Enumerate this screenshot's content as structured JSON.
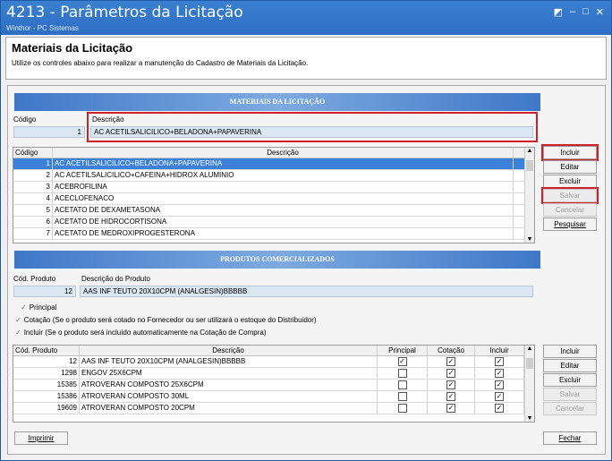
{
  "window": {
    "title": "4213 - Parâmetros da Licitação",
    "subtitle": "Winthor - PC Sistemas",
    "controls": [
      "◩",
      "–",
      "□",
      "✕"
    ]
  },
  "header": {
    "title": "Materiais da Licitação",
    "description": "Utilize os controles abaixo para realizar a manutenção do Cadastro de Materiais da Licitação."
  },
  "materiais": {
    "band": "MATERIAIS DA LICITAÇÃO",
    "codigo_label": "Código",
    "descricao_label": "Descrição",
    "codigo_value": "1",
    "descricao_value": "AC ACETILSALICILICO+BELADONA+PAPAVERINA",
    "grid": {
      "columns": [
        "Código",
        "Descrição"
      ],
      "rows": [
        {
          "codigo": "1",
          "descricao": "AC ACETILSALICILICO+BELADONA+PAPAVERINA"
        },
        {
          "codigo": "2",
          "descricao": "AC ACETILSALICILICO+CAFEINA+HIDROX ALUMINIO"
        },
        {
          "codigo": "3",
          "descricao": "ACEBROFILINA"
        },
        {
          "codigo": "4",
          "descricao": "ACECLOFENACO"
        },
        {
          "codigo": "5",
          "descricao": "ACETATO DE DEXAMETASONA"
        },
        {
          "codigo": "6",
          "descricao": "ACETATO DE HIDROCORTISONA"
        },
        {
          "codigo": "7",
          "descricao": "ACETATO DE MEDROXIPROGESTERONA"
        }
      ]
    },
    "buttons": {
      "incluir": "Incluir",
      "editar": "Editar",
      "excluir": "Excluir",
      "salvar": "Salvar",
      "cancelar": "Cancelar",
      "pesquisar": "Pesquisar"
    }
  },
  "produtos": {
    "band": "PRODUTOS COMERCIALIZADOS",
    "cod_label": "Cód. Produto",
    "desc_label": "Descrição do Produto",
    "cod_value": "12",
    "desc_value": "AAS INF TEUTO 20X10CPM (ANALGESIN)BBBBB",
    "options": [
      {
        "label": "Principal"
      },
      {
        "label": "Cotação (Se o produto será cotado no Fornecedor ou ser utilizará o estoque do Distribuidor)"
      },
      {
        "label": "Incluir     (Se o produto será incluído automaticamente na Cotação de Compra)"
      }
    ],
    "grid": {
      "columns": [
        "Cód. Produto",
        "Descrição",
        "Principal",
        "Cotação",
        "Incluir"
      ],
      "rows": [
        {
          "cod": "12",
          "desc": "AAS INF TEUTO 20X10CPM (ANALGESIN)BBBBB",
          "principal": true,
          "cotacao": true,
          "incluir": true
        },
        {
          "cod": "1298",
          "desc": "ENGOV 25X6CPM",
          "principal": false,
          "cotacao": true,
          "incluir": true
        },
        {
          "cod": "15385",
          "desc": "ATROVERAN COMPOSTO 25X6CPM",
          "principal": false,
          "cotacao": true,
          "incluir": true
        },
        {
          "cod": "15386",
          "desc": "ATROVERAN COMPOSTO 30ML",
          "principal": false,
          "cotacao": true,
          "incluir": true
        },
        {
          "cod": "19609",
          "desc": "ATROVERAN COMPOSTO 20CPM",
          "principal": false,
          "cotacao": true,
          "incluir": true
        }
      ]
    },
    "buttons": {
      "incluir": "Incluir",
      "editar": "Editar",
      "excluir": "Excluir",
      "salvar": "Salvar",
      "cancelar": "Cancelar"
    }
  },
  "footer": {
    "imprimir": "Imprimir",
    "fechar": "Fechar"
  },
  "colors": {
    "titlebar": "#2d6ec4",
    "selection": "#3b80d9",
    "highlight": "#d0202a"
  }
}
